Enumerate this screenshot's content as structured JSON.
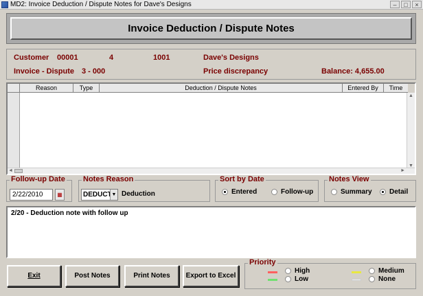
{
  "window": {
    "title": "MD2: Invoice Deduction / Dispute Notes for Dave's Designs"
  },
  "header": {
    "title": "Invoice Deduction / Dispute Notes"
  },
  "info": {
    "customer_label": "Customer",
    "customer_id": "00001",
    "field2": "4",
    "field3": "1001",
    "customer_name": "Dave's Designs",
    "invoice_label": "Invoice - Dispute",
    "invoice_value": "3 - 000",
    "reason": "Price discrepancy",
    "balance": "Balance: 4,655.00"
  },
  "grid": {
    "columns": [
      "Reason",
      "Type",
      "Deduction / Dispute Notes",
      "Entered By",
      "Time"
    ]
  },
  "followup": {
    "title": "Follow-up Date",
    "date": "2/22/2010"
  },
  "notes_reason": {
    "title": "Notes Reason",
    "selected": "DEDUCT",
    "description": "Deduction"
  },
  "sort_by": {
    "title": "Sort by Date",
    "option1": "Entered",
    "option2": "Follow-up",
    "selected": "Entered"
  },
  "notes_view": {
    "title": "Notes View",
    "option1": "Summary",
    "option2": "Detail",
    "selected": "Detail"
  },
  "notes_text": "2/20 - Deduction note with follow up",
  "buttons": {
    "exit": "Exit",
    "post": "Post Notes",
    "print": "Print Notes",
    "export": "Export to Excel"
  },
  "priority": {
    "title": "Priority",
    "high": "High",
    "low": "Low",
    "medium": "Medium",
    "none": "None",
    "colors": {
      "high": "#ff6060",
      "low": "#70e070",
      "medium": "#e8e840",
      "none": "#f0f0f0"
    }
  }
}
